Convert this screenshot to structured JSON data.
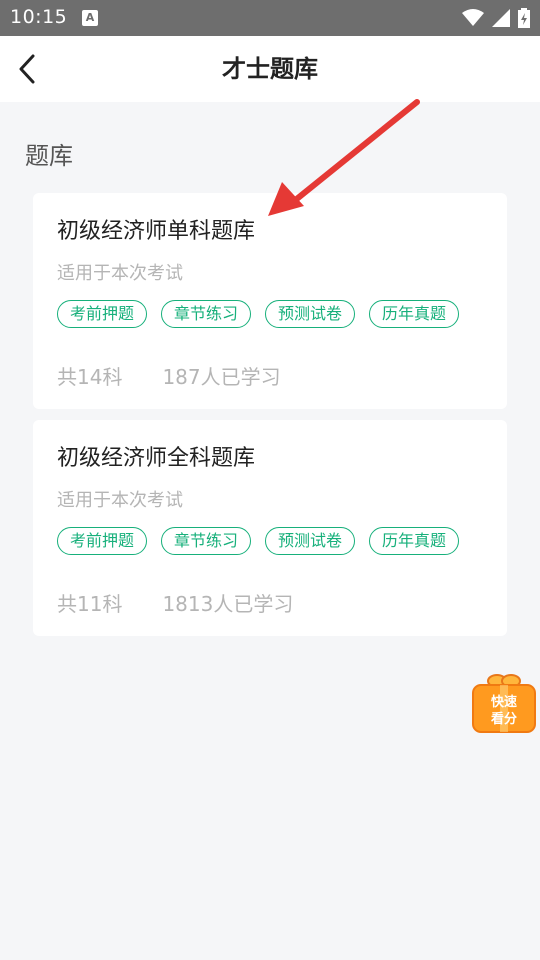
{
  "status_bar": {
    "time": "10:15",
    "notification_badge": "A"
  },
  "header": {
    "title": "才士题库"
  },
  "section": {
    "title": "题库"
  },
  "cards": [
    {
      "title": "初级经济师单科题库",
      "subtitle": "适用于本次考试",
      "tags": [
        "考前押题",
        "章节练习",
        "预测试卷",
        "历年真题"
      ],
      "subject_count": "共14科",
      "learners": "187人已学习"
    },
    {
      "title": "初级经济师全科题库",
      "subtitle": "适用于本次考试",
      "tags": [
        "考前押题",
        "章节练习",
        "预测试卷",
        "历年真题"
      ],
      "subject_count": "共11科",
      "learners": "1813人已学习"
    }
  ],
  "promo": {
    "line1": "快速",
    "line2": "看分"
  },
  "colors": {
    "accent": "#17b07b",
    "annotation_arrow": "#e53935",
    "promo": "#ff9a1f"
  }
}
